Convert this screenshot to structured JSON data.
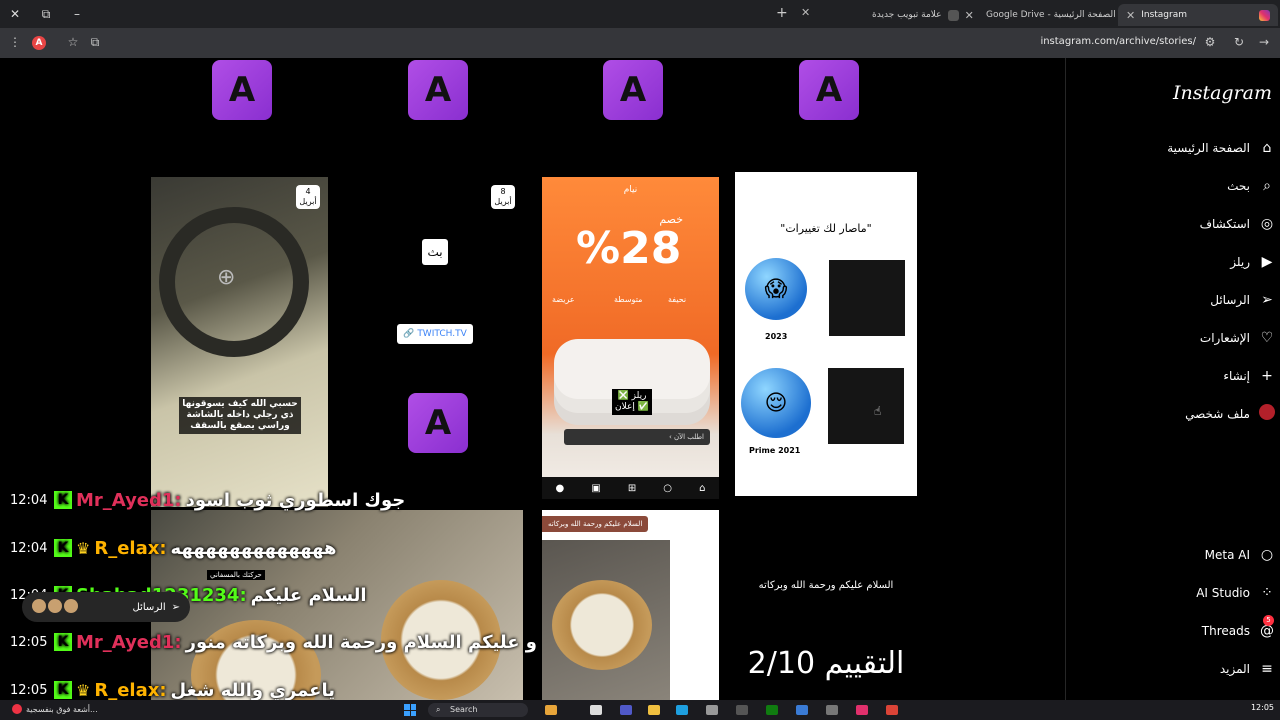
{
  "browser": {
    "tabs": [
      {
        "title": "Instagram",
        "active": true
      },
      {
        "title": "Google Drive - الصفحة الرئيسية",
        "active": false
      },
      {
        "title": "علامة تبويب جديدة",
        "active": false
      }
    ],
    "url": "instagram.com/archive/stories/"
  },
  "sidebar": {
    "logo": "Instagram",
    "items": [
      {
        "label": "الصفحة الرئيسية",
        "icon": "home-icon"
      },
      {
        "label": "بحث",
        "icon": "search-icon"
      },
      {
        "label": "استكشاف",
        "icon": "compass-icon"
      },
      {
        "label": "ريلز",
        "icon": "reels-icon"
      },
      {
        "label": "الرسائل",
        "icon": "send-icon"
      },
      {
        "label": "الإشعارات",
        "icon": "heart-icon"
      },
      {
        "label": "إنشاء",
        "icon": "plus-icon"
      },
      {
        "label": "ملف شخصي",
        "icon": "avatar"
      }
    ],
    "bottom_items": [
      {
        "label": "Meta AI",
        "icon": "meta-ai-icon"
      },
      {
        "label": "AI Studio",
        "icon": "ai-studio-icon"
      },
      {
        "label": "Threads",
        "icon": "threads-icon",
        "badge": "5"
      },
      {
        "label": "المزيد",
        "icon": "menu-icon"
      }
    ]
  },
  "stories": {
    "story1": {
      "date_day": "4",
      "date_month": "أبريل",
      "caption": "حسبي الله كيف يسوقونها ذي رجلي داخله بالشاشة وراسي يصقع بالسقف"
    },
    "story2": {
      "date_day": "8",
      "date_month": "أبريل",
      "sticker": "بث",
      "link": "TWITCH.TV"
    },
    "story3": {
      "brand": "نيام",
      "discount_label": "خصم",
      "discount": "%28",
      "options": [
        "عريضة",
        "متوسطة",
        "نحيفة"
      ],
      "promo": "ريلز ❎ إعلان ✅",
      "cta": "اطلب الآن"
    },
    "story4": {
      "title": "\"ماصار لك تغييرات\"",
      "label_top": "2023",
      "label_bottom": "Prime 2021"
    },
    "story5": {
      "tag": "حركتك بالمسفاني"
    },
    "story6": {
      "tag": "السلام عليكم ورحمة الله وبركاته"
    },
    "story7": {
      "greeting": "السلام عليكم ورحمة الله وبركاته",
      "rating": "التقييم 2/10"
    }
  },
  "chat": [
    {
      "time": "12:04",
      "user": "Mr_Ayed1:",
      "user_color": "#e0305a",
      "crown": false,
      "message": "جوك اسطوري ثوب اسود"
    },
    {
      "time": "12:04",
      "user": "R_elax:",
      "user_color": "#ffb300",
      "crown": true,
      "message": "هههههههههههههه"
    },
    {
      "time": "12:04",
      "user": "Shahad1231234:",
      "user_color": "#53fc18",
      "crown": false,
      "message": "السلام عليكم"
    },
    {
      "time": "12:05",
      "user": "Mr_Ayed1:",
      "user_color": "#e0305a",
      "crown": false,
      "message": "و عليكم السلام ورحمة الله وبركاته منور"
    },
    {
      "time": "12:05",
      "user": "R_elax:",
      "user_color": "#ffb300",
      "crown": true,
      "message": "ياعمري والله شغل"
    }
  ],
  "messages_pill": {
    "label": "الرسائل"
  },
  "taskbar": {
    "news": "أشعة فوق بنفسجية...",
    "search_placeholder": "Search",
    "clock": "12:05"
  }
}
